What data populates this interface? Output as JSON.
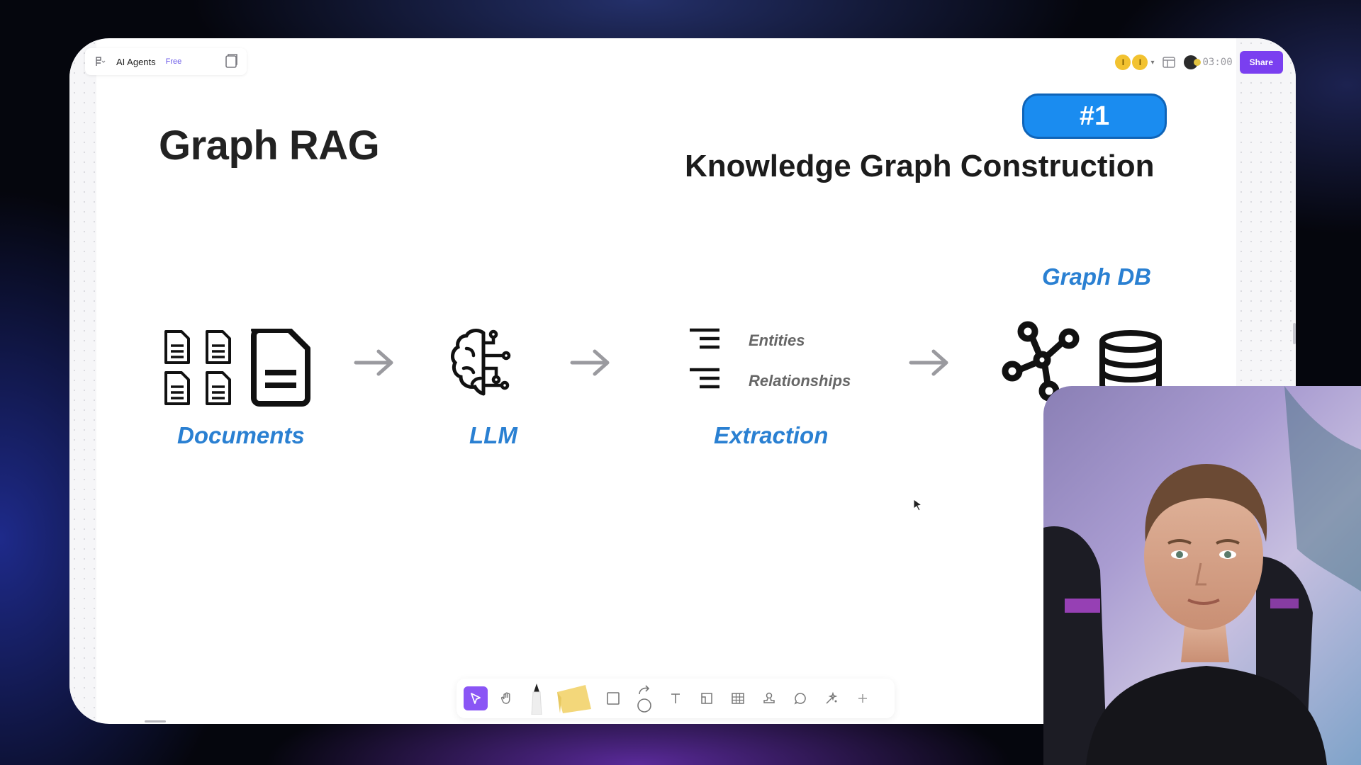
{
  "topbar": {
    "board_name": "AI Agents",
    "plan_badge": "Free",
    "avatars": [
      "I",
      "I"
    ],
    "timer": "03:00",
    "share_label": "Share"
  },
  "slide": {
    "title": "Graph RAG",
    "step_badge": "#1",
    "subtitle": "Knowledge Graph Construction",
    "flow": {
      "documents_label": "Documents",
      "llm_label": "LLM",
      "extraction_label": "Extraction",
      "extraction_items": [
        "Entities",
        "Relationships"
      ],
      "graphdb_label": "Graph DB"
    }
  },
  "colors": {
    "accent_blue": "#2a80d2",
    "badge_blue": "#1a8cf0",
    "share_purple": "#7a3ff0",
    "select_purple": "#8a55f5"
  },
  "toolbar_icons": [
    "select-icon",
    "hand-icon",
    "pen-icon",
    "sticky-note-icon",
    "shape-icon",
    "connector-icon",
    "text-icon",
    "frame-icon",
    "table-icon",
    "stamp-icon",
    "comment-icon",
    "ai-icon",
    "plus-icon"
  ]
}
